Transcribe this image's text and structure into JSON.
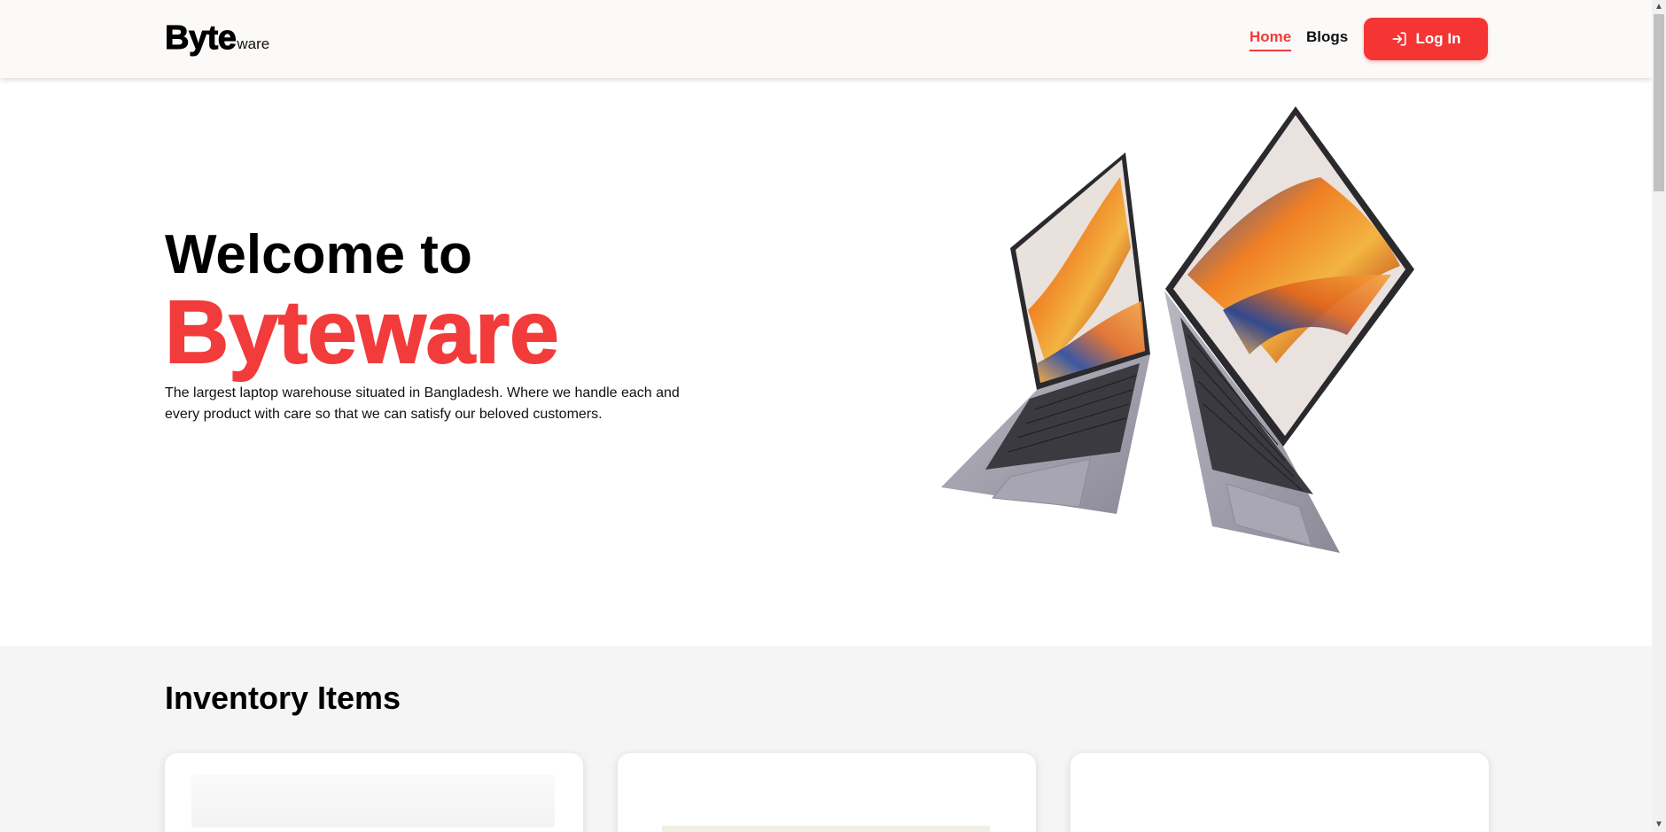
{
  "header": {
    "brand_main": "Byte",
    "brand_sub": "ware",
    "nav": [
      {
        "label": "Home",
        "active": true
      },
      {
        "label": "Blogs",
        "active": false
      }
    ],
    "login_label": "Log In",
    "login_icon": "login-arrow-icon"
  },
  "hero": {
    "title_line1": "Welcome to",
    "title_line2": "Byteware",
    "description": "The largest laptop warehouse situated in Bangladesh. Where we handle each and every product with care so that we can satisfy our beloved customers."
  },
  "inventory": {
    "title": "Inventory Items"
  },
  "colors": {
    "accent": "#f23b3b",
    "header_bg": "#fbfaf8",
    "section_bg": "#f5f5f5"
  }
}
